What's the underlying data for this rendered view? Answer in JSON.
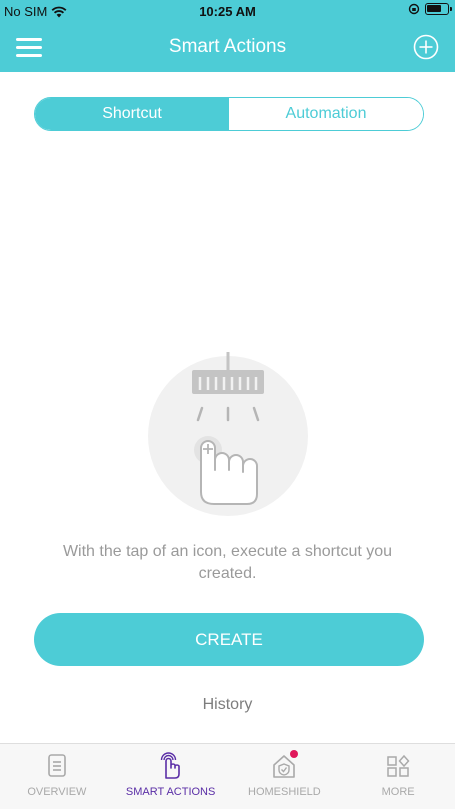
{
  "status_bar": {
    "carrier": "No SIM",
    "time": "10:25 AM"
  },
  "navbar": {
    "title": "Smart Actions"
  },
  "segments": {
    "shortcut": "Shortcut",
    "automation": "Automation",
    "selected": "Shortcut"
  },
  "empty_state": {
    "message": "With the tap of an icon, execute a shortcut you created."
  },
  "actions": {
    "create": "CREATE",
    "history": "History"
  },
  "tabbar": {
    "items": [
      {
        "label": "OVERVIEW",
        "icon": "document-icon",
        "active": false
      },
      {
        "label": "SMART ACTIONS",
        "icon": "tap-hand-icon",
        "active": true
      },
      {
        "label": "HOMESHIELD",
        "icon": "home-shield-icon",
        "active": false,
        "badge": true
      },
      {
        "label": "MORE",
        "icon": "grid-more-icon",
        "active": false
      }
    ]
  },
  "colors": {
    "accent": "#4dccd6",
    "active_tab": "#5a2ea6",
    "badge": "#e0185b"
  }
}
